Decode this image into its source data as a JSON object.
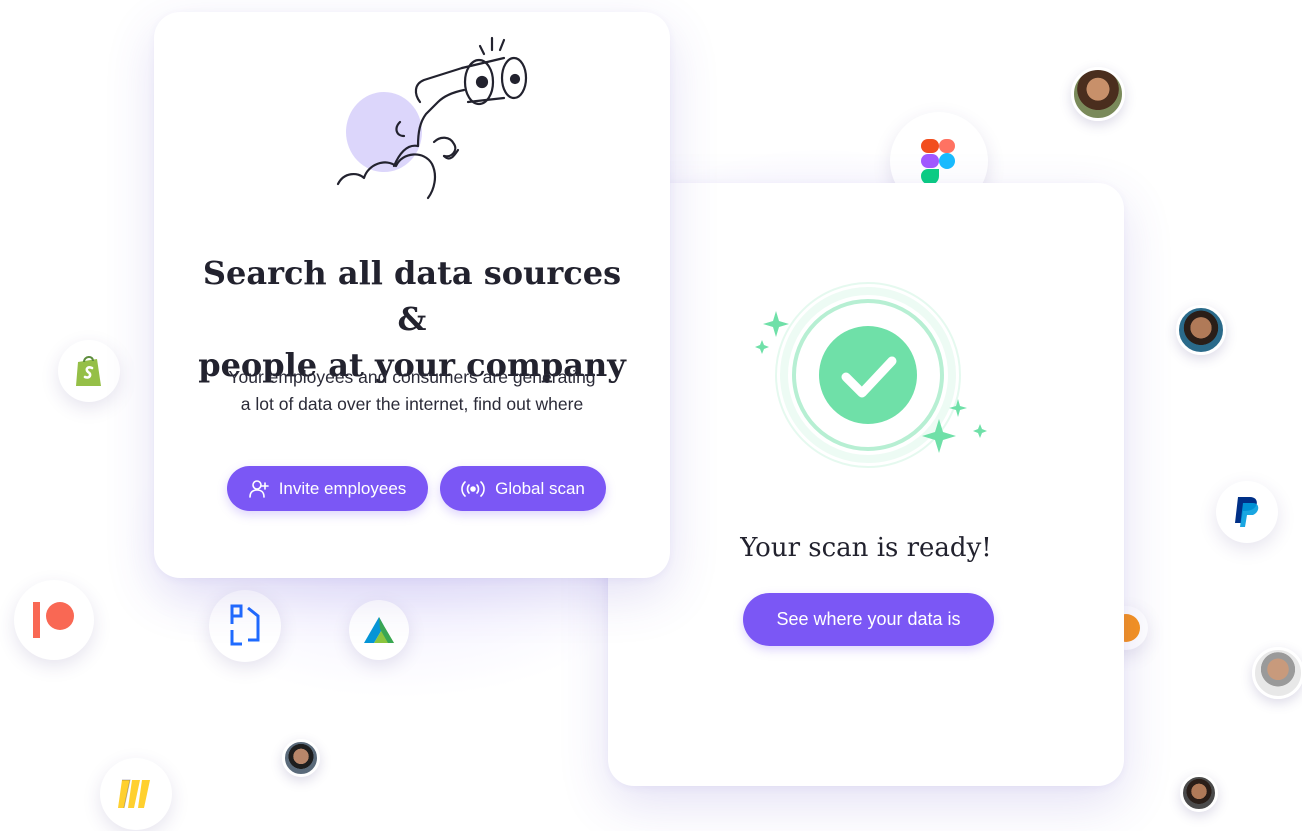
{
  "card_search": {
    "title_line1": "Search all data sources &",
    "title_line2": "people at your company",
    "description_line1": "Your employees and consumers are generating",
    "description_line2": "a lot of data over the internet, find out where",
    "invite_button_label": "Invite employees",
    "scan_button_label": "Global scan"
  },
  "card_ready": {
    "title": "Your scan is ready!",
    "cta_label": "See where your data is"
  },
  "colors": {
    "accent": "#7b57f5",
    "success": "#6fe0a8",
    "text": "#22222e"
  },
  "icons": [
    "binoculars-illustration-icon",
    "user-plus-icon",
    "broadcast-icon",
    "check-circle-icon",
    "figma-logo-icon",
    "shopify-logo-icon",
    "patreon-logo-icon",
    "productboard-logo-icon",
    "autodesk-logo-icon",
    "miro-logo-icon",
    "paypal-logo-icon",
    "orange-logo-icon"
  ]
}
